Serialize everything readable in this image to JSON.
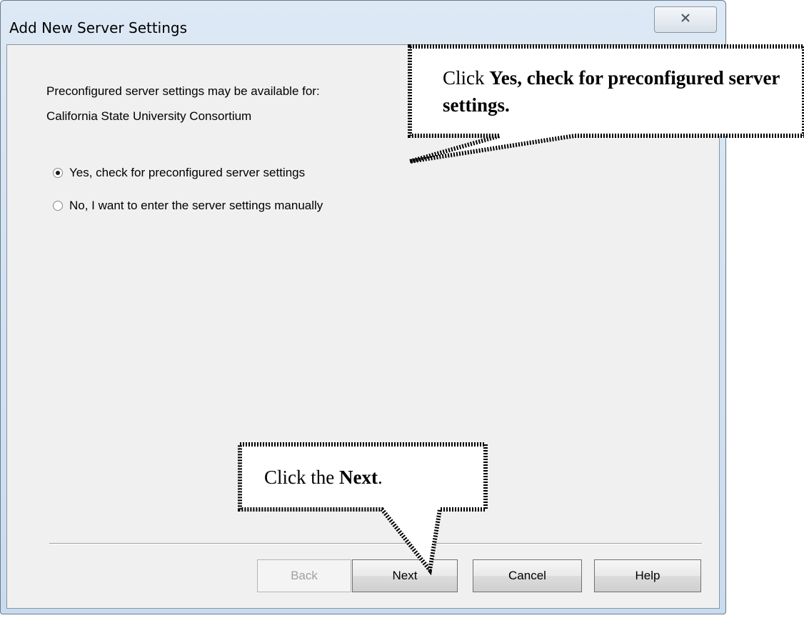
{
  "window": {
    "title": "Add New Server Settings",
    "close_glyph": "⨯",
    "close_icon": "close-icon"
  },
  "intro": {
    "line1": "Preconfigured server settings may be available for:",
    "line2": "California State University Consortium"
  },
  "options": [
    {
      "label": "Yes, check for preconfigured server settings",
      "checked": true
    },
    {
      "label": "No, I want to enter the server settings manually",
      "checked": false
    }
  ],
  "buttons": {
    "back": "Back",
    "next": "Next",
    "cancel": "Cancel",
    "help": "Help"
  },
  "callouts": {
    "top": {
      "prefix": "Click ",
      "bold": "Yes, check for preconfigured server settings."
    },
    "bottom": {
      "prefix": "Click the ",
      "bold": "Next",
      "suffix": "."
    }
  },
  "colors": {
    "window_frame": "#6b7b8c",
    "client_bg": "#f0f0f0",
    "callout_border": "#000000"
  }
}
